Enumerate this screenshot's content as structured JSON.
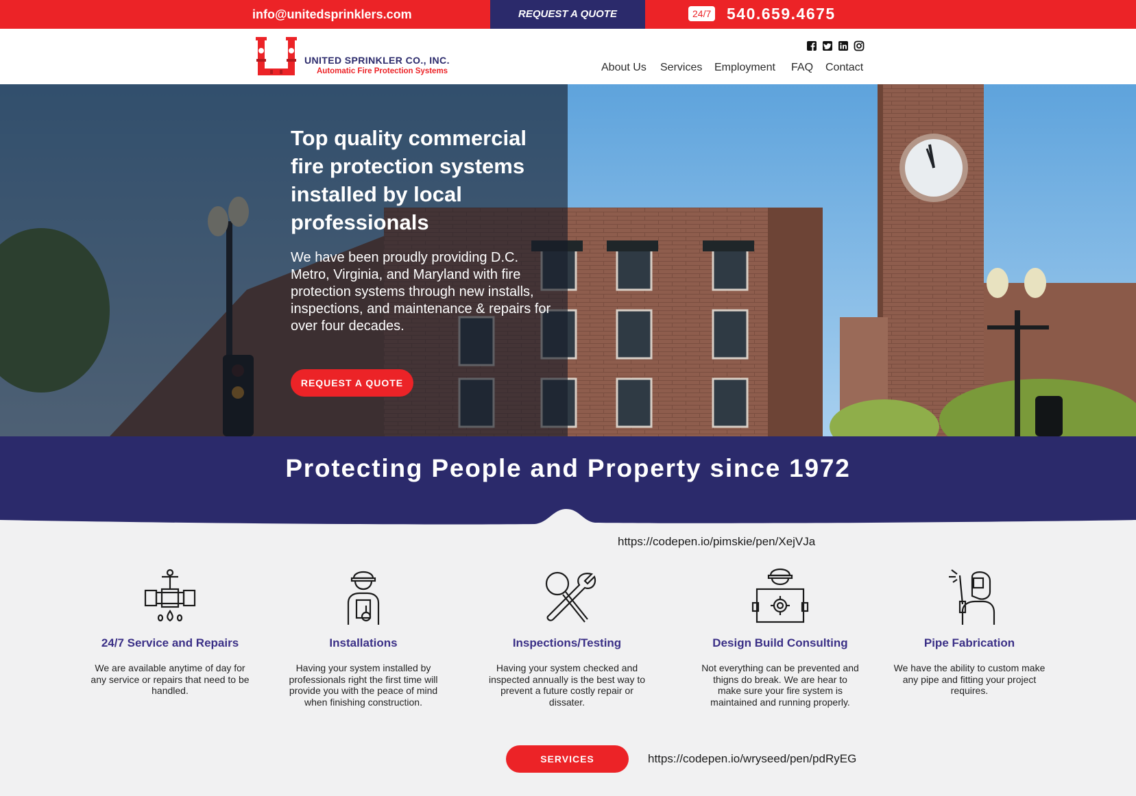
{
  "topbar": {
    "email": "info@unitedsprinklers.com",
    "quote_label": "REQUEST A QUOTE",
    "badge_247": "24/7",
    "phone": "540.659.4675"
  },
  "header": {
    "logo_name": "UNITED SPRINKLER CO., INC.",
    "logo_tagline": "Automatic Fire Protection Systems",
    "social_icons": [
      "facebook-icon",
      "twitter-icon",
      "linkedin-icon",
      "instagram-icon"
    ],
    "nav": [
      "About Us",
      "Services",
      "Employment",
      "FAQ",
      "Contact"
    ]
  },
  "hero": {
    "title": "Top quality commercial fire protection systems installed by local professionals",
    "text": "We have been proudly providing D.C. Metro, Virginia, and Maryland with fire protection systems through new installs, inspections, and maintenance & repairs for over four decades.",
    "button": "REQUEST A QUOTE"
  },
  "band": {
    "title": "Protecting People and Property since 1972"
  },
  "urls": {
    "first": "https://codepen.io/pimskie/pen/XejVJa",
    "second": "https://codepen.io/wryseed/pen/pdRyEG"
  },
  "services": [
    {
      "title": "24/7 Service and Repairs",
      "text": "We are available anytime of day for any service or repairs that need to be handled.",
      "icon": "pipe-valve-icon"
    },
    {
      "title": "Installations",
      "text": "Having your system installed by professionals right the first time will provide you with the peace of mind when finishing construction.",
      "icon": "worker-icon"
    },
    {
      "title": "Inspections/Testing",
      "text": "Having your system checked and inspected annually is the best way to prevent a future costly repair or dissater.",
      "icon": "tools-icon"
    },
    {
      "title": "Design Build Consulting",
      "text": "Not everything can be prevented and thigns do break. We are hear to make sure your fire system is maintained and running properly.",
      "icon": "blueprint-worker-icon"
    },
    {
      "title": "Pipe Fabrication",
      "text": "We have the ability to custom make any pipe and fitting your project requires.",
      "icon": "welder-icon"
    }
  ],
  "services_button": "SERVICES",
  "colors": {
    "brand_red": "#ec2327",
    "brand_navy": "#2b2a6b",
    "service_title": "#3a2f86"
  }
}
